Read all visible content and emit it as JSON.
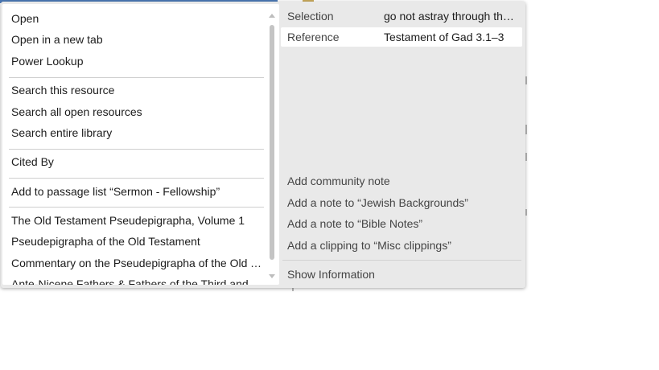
{
  "menu": {
    "items": [
      {
        "label": "Open"
      },
      {
        "label": "Open in a new tab"
      },
      {
        "label": "Power Lookup"
      },
      {
        "label": "Search this resource"
      },
      {
        "label": "Search all open resources"
      },
      {
        "label": "Search entire library"
      },
      {
        "label": "Cited By"
      },
      {
        "label": "Add to passage list “Sermon - Fellowship”"
      },
      {
        "label": "The Old Testament Pseudepigrapha, Volume 1"
      },
      {
        "label": "Pseudepigrapha of the Old Testament"
      },
      {
        "label": "Commentary on the Pseudepigrapha of the Old Testament"
      },
      {
        "label": "Ante-Nicene Fathers & Fathers of the Third and Fourth Centuries"
      }
    ]
  },
  "info_panel": {
    "selection_label": "Selection",
    "selection_value": "go not astray through the spirit of hatred",
    "reference_label": "Reference",
    "reference_value": "Testament of Gad 3.1–3"
  },
  "panel_actions": {
    "add_community_note": "Add community note",
    "add_note_jewish": "Add a note to “Jewish Backgrounds”",
    "add_note_bible": "Add a note to “Bible Notes”",
    "add_clipping": "Add a clipping to “Misc clippings”",
    "show_information": "Show Information"
  },
  "colors": {
    "panel_background": "#e9e9e9",
    "menu_background": "#ffffff",
    "text": "#1c1c1c",
    "muted_text": "#444444"
  }
}
